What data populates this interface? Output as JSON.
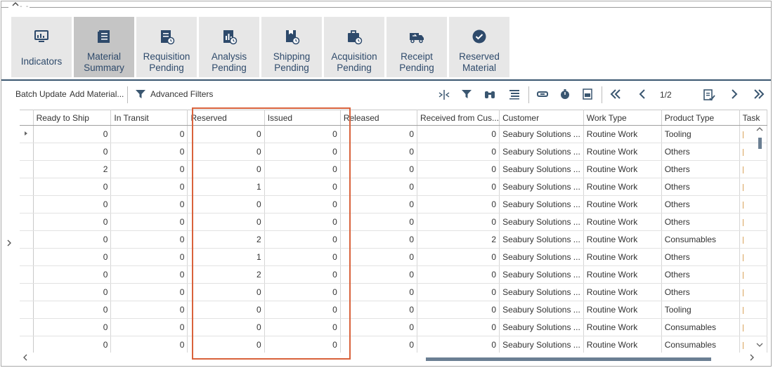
{
  "header": {
    "collapse_glyph": "^",
    "dashes": "- -"
  },
  "ribbon": {
    "tiles": [
      {
        "label1": "Indicators",
        "label2": "",
        "icon": "monitor-chart-icon"
      },
      {
        "label1": "Material",
        "label2": "Summary",
        "icon": "document-list-icon",
        "active": true
      },
      {
        "label1": "Requisition",
        "label2": "Pending",
        "icon": "requisition-clock-icon"
      },
      {
        "label1": "Analysis",
        "label2": "Pending",
        "icon": "analysis-chart-icon"
      },
      {
        "label1": "Shipping",
        "label2": "Pending",
        "icon": "shipping-box-icon"
      },
      {
        "label1": "Acquisition",
        "label2": "Pending",
        "icon": "briefcase-clock-icon"
      },
      {
        "label1": "Receipt",
        "label2": "Pending",
        "icon": "truck-icon"
      },
      {
        "label1": "Reserved",
        "label2": "Material",
        "icon": "check-circle-icon"
      }
    ]
  },
  "toolbar": {
    "batch_update": "Batch Update",
    "add_material": "Add Material...",
    "advanced_filters": "Advanced Filters",
    "page_indicator": "1/2"
  },
  "grid": {
    "columns": [
      "Ready to Ship",
      "In Transit",
      "Reserved",
      "Issued",
      "Released",
      "Received from Cus...",
      "Customer",
      "Work Type",
      "Product Type",
      "Task"
    ],
    "rows": [
      [
        "0",
        "0",
        "0",
        "0",
        "0",
        "0",
        "Seabury Solutions ...",
        "Routine Work",
        "Tooling"
      ],
      [
        "0",
        "0",
        "0",
        "0",
        "0",
        "0",
        "Seabury Solutions ...",
        "Routine Work",
        "Others"
      ],
      [
        "2",
        "0",
        "0",
        "0",
        "0",
        "0",
        "Seabury Solutions ...",
        "Routine Work",
        "Others"
      ],
      [
        "0",
        "0",
        "1",
        "0",
        "0",
        "0",
        "Seabury Solutions ...",
        "Routine Work",
        "Others"
      ],
      [
        "0",
        "0",
        "0",
        "0",
        "0",
        "0",
        "Seabury Solutions ...",
        "Routine Work",
        "Others"
      ],
      [
        "0",
        "0",
        "0",
        "0",
        "0",
        "0",
        "Seabury Solutions ...",
        "Routine Work",
        "Others"
      ],
      [
        "0",
        "0",
        "2",
        "0",
        "0",
        "2",
        "Seabury Solutions ...",
        "Routine Work",
        "Consumables"
      ],
      [
        "0",
        "0",
        "1",
        "0",
        "0",
        "0",
        "Seabury Solutions ...",
        "Routine Work",
        "Others"
      ],
      [
        "0",
        "0",
        "2",
        "0",
        "0",
        "0",
        "Seabury Solutions ...",
        "Routine Work",
        "Others"
      ],
      [
        "0",
        "0",
        "0",
        "0",
        "0",
        "0",
        "Seabury Solutions ...",
        "Routine Work",
        "Others"
      ],
      [
        "0",
        "0",
        "0",
        "0",
        "0",
        "0",
        "Seabury Solutions ...",
        "Routine Work",
        "Tooling"
      ],
      [
        "0",
        "0",
        "0",
        "0",
        "0",
        "0",
        "Seabury Solutions ...",
        "Routine Work",
        "Consumables"
      ],
      [
        "0",
        "0",
        "0",
        "0",
        "0",
        "0",
        "Seabury Solutions ...",
        "Routine Work",
        "Consumables"
      ]
    ]
  },
  "colors": {
    "accent": "#3a5670",
    "highlight": "#d9623b",
    "tile_bg": "#e7e7e7",
    "tile_active": "#c5c5c5"
  }
}
